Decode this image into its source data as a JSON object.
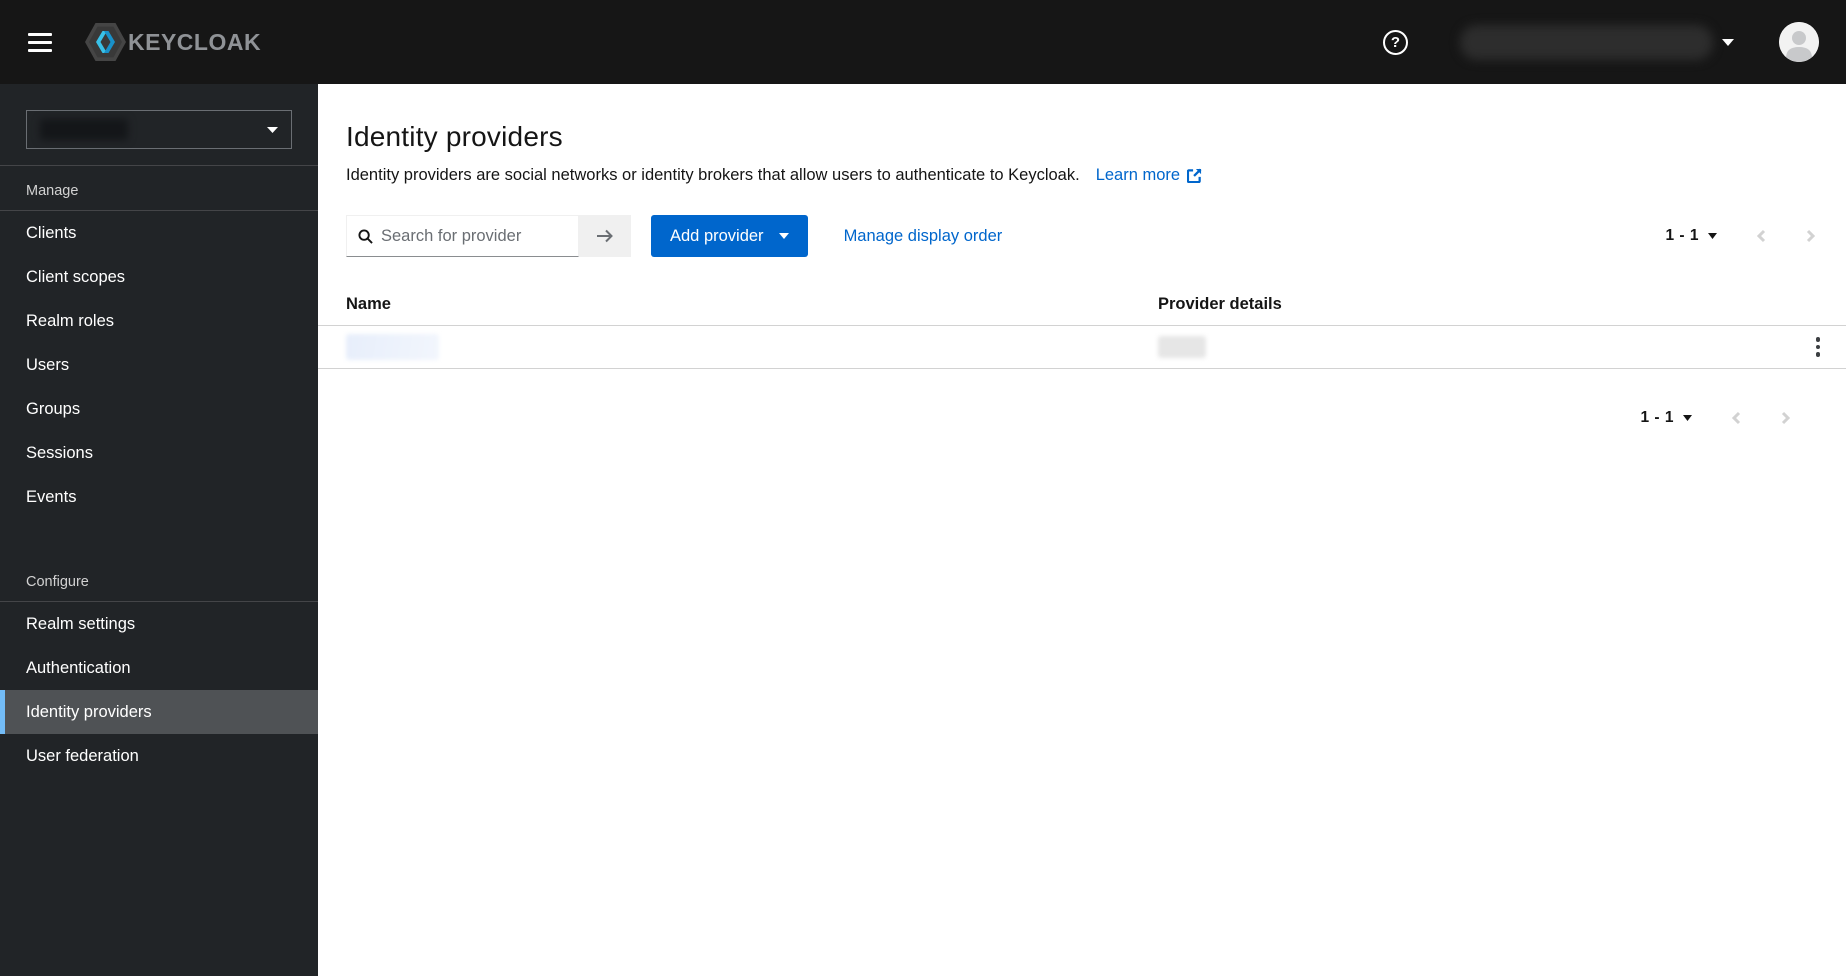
{
  "masthead": {
    "brand": "KEYCLOAK"
  },
  "sidebar": {
    "manage": {
      "label": "Manage",
      "items": [
        "Clients",
        "Client scopes",
        "Realm roles",
        "Users",
        "Groups",
        "Sessions",
        "Events"
      ]
    },
    "configure": {
      "label": "Configure",
      "items": [
        "Realm settings",
        "Authentication",
        "Identity providers",
        "User federation"
      ],
      "active_item": "Identity providers"
    }
  },
  "page": {
    "title": "Identity providers",
    "description": "Identity providers are social networks or identity brokers that allow users to authenticate to Keycloak.",
    "learn_more_label": "Learn more"
  },
  "toolbar": {
    "search_placeholder": "Search for provider",
    "add_provider_label": "Add provider",
    "manage_display_order_label": "Manage display order"
  },
  "table": {
    "columns": {
      "name": "Name",
      "details": "Provider details"
    }
  },
  "pagination": {
    "range": "1 - 1"
  },
  "colors": {
    "accent": "#0066cc",
    "link": "#0066cc",
    "masthead_bg": "#161616",
    "sidebar_bg": "#212427",
    "active_nav_bg": "#4f5255",
    "active_nav_border": "#73bcf7",
    "logo_cyan": "#39c1e8",
    "logo_blue": "#1991c9"
  }
}
